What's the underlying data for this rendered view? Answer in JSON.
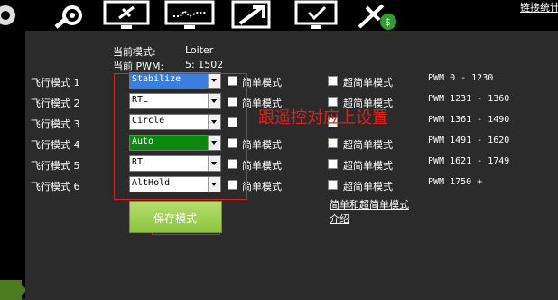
{
  "toolbar": {
    "icons": [
      "gear-wrench-icon",
      "monitor-plane-icon",
      "monitor-chart-icon",
      "monitor-arrow-icon",
      "monitor-check-icon",
      "plane-dollar-icon"
    ],
    "link_label": "链接统计"
  },
  "status": {
    "mode_label": "当前模式:",
    "mode_value": "Loiter",
    "pwm_label": "当前 PWM:",
    "pwm_value": "5: 1502"
  },
  "modes": [
    {
      "label": "飞行模式 1",
      "value": "Stabilize",
      "simple": "简单模式",
      "super_simple": "超简单模式",
      "pwm": "PWM 0 - 1230"
    },
    {
      "label": "飞行模式 2",
      "value": "RTL",
      "simple": "简单模式",
      "super_simple": "超简单模式",
      "pwm": "PWM 1231 - 1360"
    },
    {
      "label": "飞行模式 3",
      "value": "Circle",
      "simple": "",
      "super_simple": "",
      "pwm": "PWM 1361 - 1490"
    },
    {
      "label": "飞行模式 4",
      "value": "Auto",
      "simple": "简单模式",
      "super_simple": "超简单模式",
      "pwm": "PWM 1491 - 1620"
    },
    {
      "label": "飞行模式 5",
      "value": "RTL",
      "simple": "简单模式",
      "super_simple": "超简单模式",
      "pwm": "PWM 1621 - 1749"
    },
    {
      "label": "飞行模式 6",
      "value": "AltHold",
      "simple": "简单模式",
      "super_simple": "超简单模式",
      "pwm": "PWM 1750 +"
    }
  ],
  "help_link_line1": "简单和超简单模式",
  "help_link_line2": "介绍",
  "save_button": "保存模式",
  "annotation_text": "跟遥控对应上设置",
  "colors": {
    "highlight_blue": "#3a7fe0",
    "highlight_green": "#0a8a0a",
    "annotation_red": "#e02020",
    "save_green": "#8cc43f"
  }
}
